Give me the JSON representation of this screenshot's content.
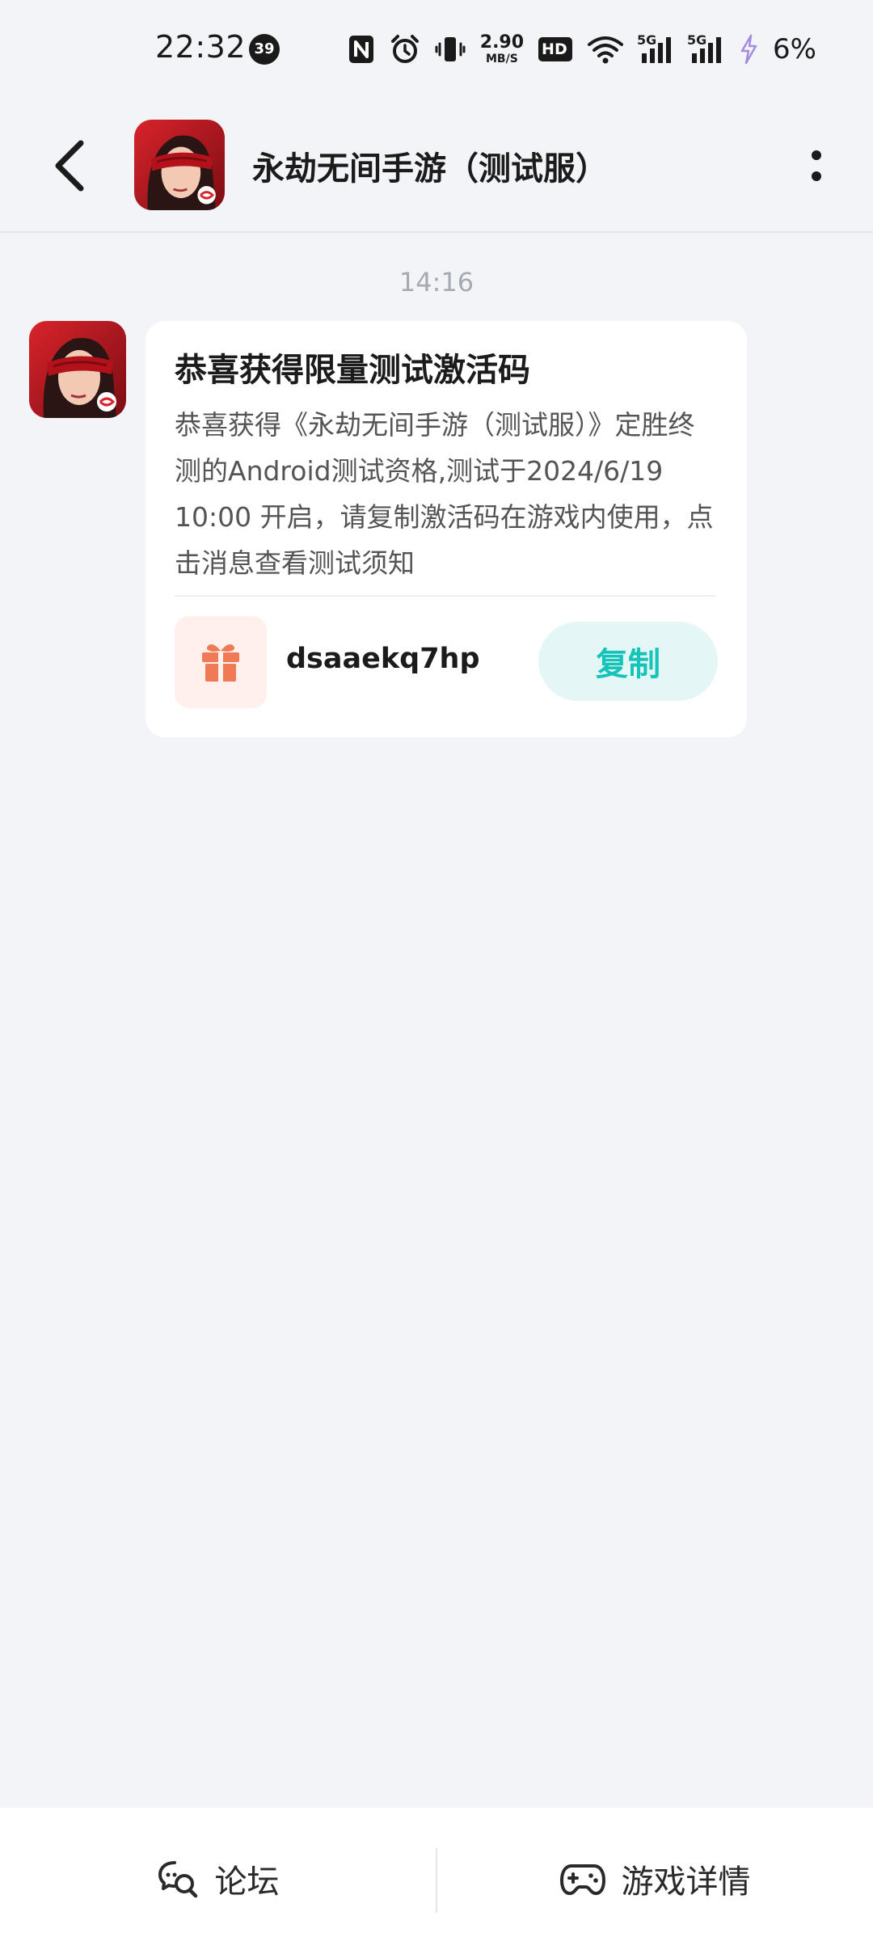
{
  "status_bar": {
    "time": "22:32",
    "notification_count": "39",
    "net_speed_value": "2.90",
    "net_speed_unit": "MB/S",
    "hd_label": "HD",
    "signal1_label": "5G",
    "signal2_label": "5G",
    "battery": "6%"
  },
  "header": {
    "title": "永劫无间手游（测试服）"
  },
  "chat": {
    "timestamp": "14:16",
    "card": {
      "title": "恭喜获得限量测试激活码",
      "body": "恭喜获得《永劫无间手游（测试服）》定胜终测的Android测试资格,测试于2024/6/19 10:00 开启，请复制激活码在游戏内使用，点击消息查看测试须知",
      "code": "dsaaekq7hp",
      "copy_label": "复制"
    }
  },
  "bottom_bar": {
    "forum_label": "论坛",
    "detail_label": "游戏详情"
  },
  "colors": {
    "accent": "#16c3b8",
    "background": "#f3f4f7",
    "gift": "#f07a55"
  }
}
